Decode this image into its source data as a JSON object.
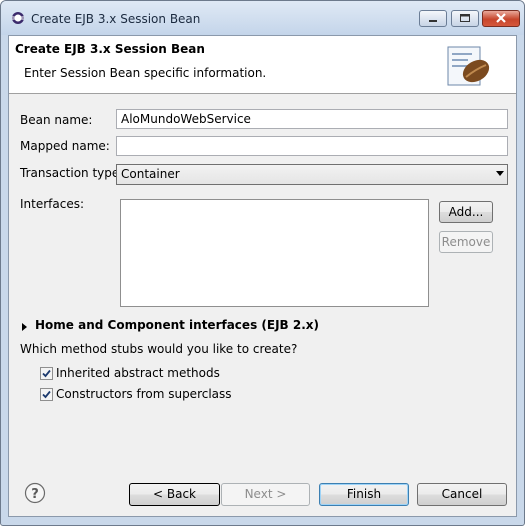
{
  "window": {
    "title": "Create EJB 3.x Session Bean"
  },
  "banner": {
    "title": "Create EJB 3.x Session Bean",
    "description": "Enter Session Bean specific information."
  },
  "form": {
    "bean_name_label": "Bean name:",
    "bean_name_value": "AloMundoWebService",
    "mapped_name_label": "Mapped name:",
    "mapped_name_value": "",
    "transaction_type_label": "Transaction type:",
    "transaction_type_value": "Container",
    "interfaces_label": "Interfaces:",
    "add_button": "Add...",
    "remove_button": "Remove",
    "home_component_label": "Home and Component interfaces (EJB 2.x)",
    "stubs_question": "Which method stubs would you like to create?",
    "checkboxes": [
      {
        "label": "Inherited abstract methods",
        "checked": true
      },
      {
        "label": "Constructors from superclass",
        "checked": true
      }
    ]
  },
  "footer": {
    "back_button": "< Back",
    "next_button": "Next >",
    "finish_button": "Finish",
    "cancel_button": "Cancel"
  }
}
